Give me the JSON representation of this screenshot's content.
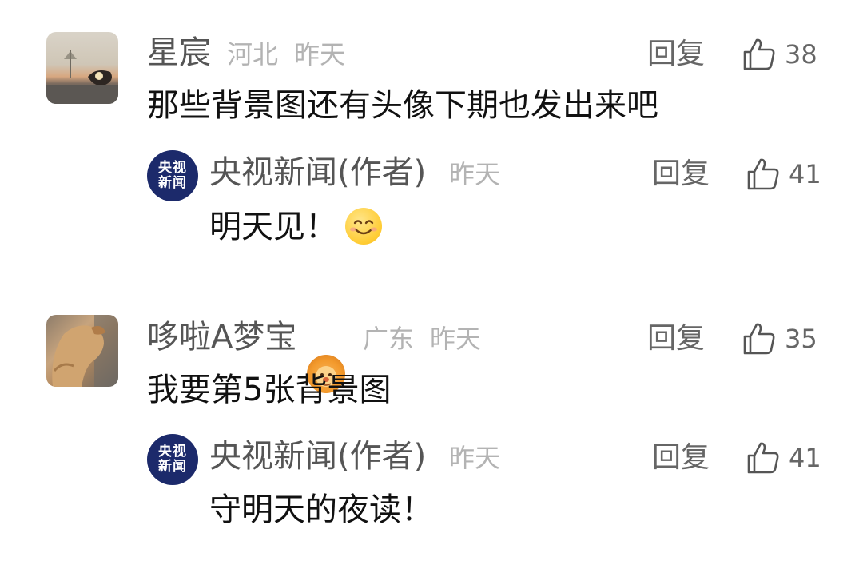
{
  "comments": [
    {
      "user": "星宸",
      "location": "河北",
      "time": "昨天",
      "reply_label": "回复",
      "likes": "38",
      "text": "那些背景图还有头像下期也发出来吧",
      "author_reply": {
        "user": "央视新闻(作者)",
        "time": "昨天",
        "reply_label": "回复",
        "likes": "41",
        "text": "明天见！",
        "logo_line1": "央视",
        "logo_line2": "新闻"
      }
    },
    {
      "user": "哆啦A梦宝",
      "location": "广东",
      "time": "昨天",
      "reply_label": "回复",
      "likes": "35",
      "text": "我要第5张背景图",
      "author_reply": {
        "user": "央视新闻(作者)",
        "time": "昨天",
        "reply_label": "回复",
        "likes": "41",
        "text": "守明天的夜读！",
        "logo_line1": "央视",
        "logo_line2": "新闻"
      }
    }
  ],
  "icons": {
    "like": "thumbs-up-icon",
    "smile": "smiling-face-emoji",
    "lion": "lion-face-emoji"
  }
}
